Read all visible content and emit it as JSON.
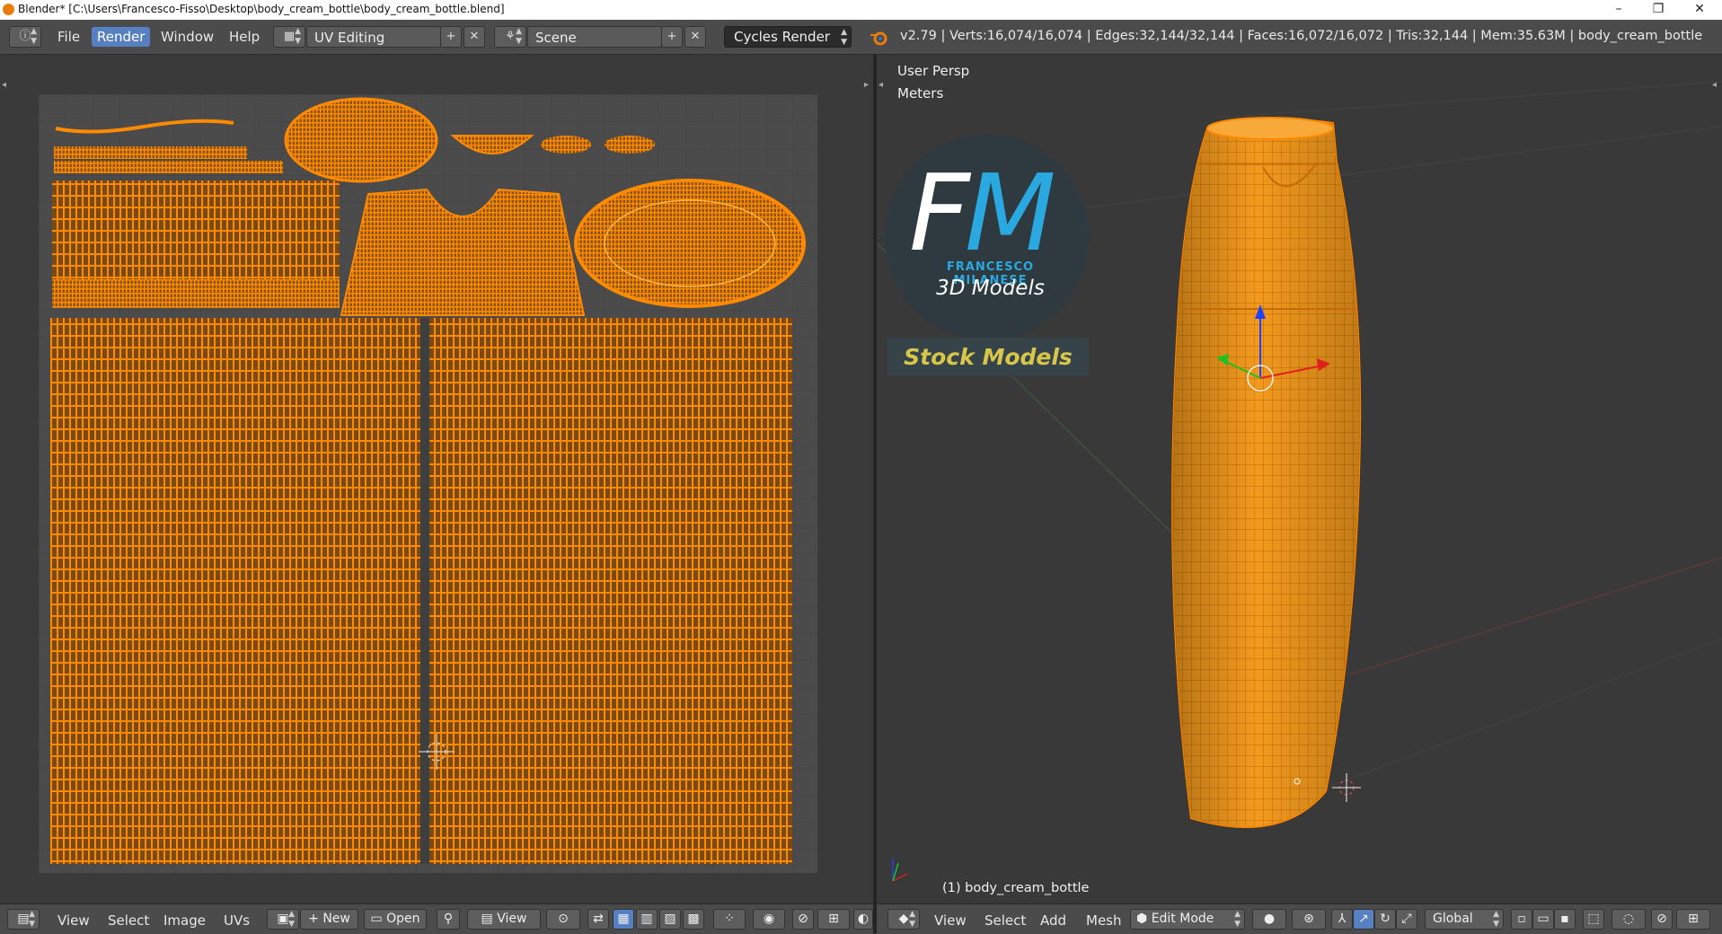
{
  "window": {
    "title": "Blender* [C:\\Users\\Francesco-Fisso\\Desktop\\body_cream_bottle\\body_cream_bottle.blend]",
    "min_glyph": "–",
    "restore_glyph": "❐",
    "close_glyph": "✕"
  },
  "topbar": {
    "menus": [
      "File",
      "Render",
      "Window",
      "Help"
    ],
    "active_menu": "Render",
    "screen_layout": "UV Editing",
    "scene": "Scene",
    "render_engine": "Cycles Render",
    "stats": "v2.79 | Verts:16,074/16,074 | Edges:32,144/32,144 | Faces:16,072/16,072 | Tris:32,144 | Mem:35.63M | body_cream_bottle"
  },
  "uv_editor": {
    "menus": [
      "View",
      "Select",
      "Image",
      "UVs"
    ],
    "new_label": "New",
    "open_label": "Open",
    "view_label": "View"
  },
  "viewport": {
    "view_name": "User Persp",
    "units": "Meters",
    "object_label": "(1) body_cream_bottle",
    "menus": [
      "View",
      "Select",
      "Add",
      "Mesh"
    ],
    "mode": "Edit Mode",
    "orientation": "Global"
  },
  "logo": {
    "letters_f": "F",
    "letters_m": "M",
    "name": "FRANCESCO MILANESE",
    "subtitle": "3D Models",
    "badge": "Stock Models"
  },
  "colors": {
    "accent": "#5680c2",
    "uv_orange": "#ff8a00",
    "brand_blue": "#29a9e0",
    "badge_yellow": "#d8c64a"
  },
  "icons": [
    "info-icon",
    "layout-icon",
    "scene-icon",
    "blender-icon",
    "image-icon",
    "cube-icon"
  ]
}
